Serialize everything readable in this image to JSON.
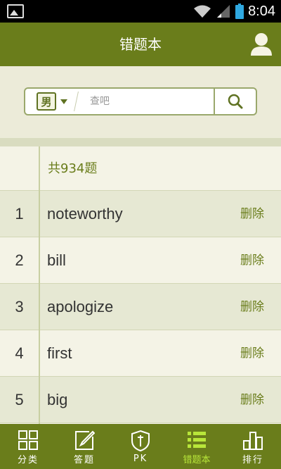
{
  "status_bar": {
    "time": "8:04"
  },
  "header": {
    "title": "错题本"
  },
  "search": {
    "dict_label": "男",
    "placeholder": "查吧"
  },
  "list": {
    "count_label": "共934题",
    "delete_label": "删除",
    "items": [
      {
        "num": "1",
        "word": "noteworthy"
      },
      {
        "num": "2",
        "word": "bill"
      },
      {
        "num": "3",
        "word": "apologize"
      },
      {
        "num": "4",
        "word": "first"
      },
      {
        "num": "5",
        "word": "big"
      }
    ]
  },
  "nav": [
    {
      "label": "分类",
      "icon": "category-grid-icon"
    },
    {
      "label": "答题",
      "icon": "answer-pencil-icon"
    },
    {
      "label": "PK",
      "icon": "pk-shield-icon"
    },
    {
      "label": "错题本",
      "icon": "mistake-book-icon",
      "active": true
    },
    {
      "label": "排行",
      "icon": "ranking-icon"
    }
  ],
  "colors": {
    "primary": "#6a7d1b",
    "active": "#b8e63a",
    "background": "#ecebd9"
  }
}
